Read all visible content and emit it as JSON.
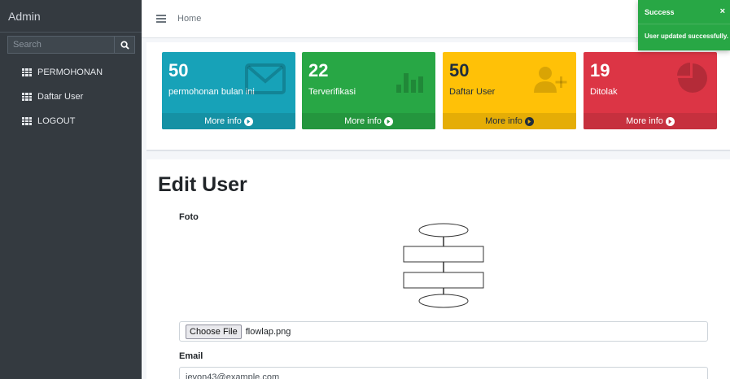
{
  "sidebar": {
    "brand": "Admin",
    "search_placeholder": "Search",
    "items": [
      {
        "label": "PERMOHONAN"
      },
      {
        "label": "Daftar User"
      },
      {
        "label": "LOGOUT"
      }
    ]
  },
  "topbar": {
    "home": "Home"
  },
  "boxes": [
    {
      "number": "50",
      "label": "permohonan bulan ini",
      "footer": "More info",
      "color": "#17a2b8",
      "icon": "envelope-icon"
    },
    {
      "number": "22",
      "label": "Terverifikasi",
      "footer": "More info",
      "color": "#28a745",
      "icon": "bar-chart-icon"
    },
    {
      "number": "50",
      "label": "Daftar User",
      "footer": "More info",
      "color": "#ffc107",
      "icon": "user-plus-icon"
    },
    {
      "number": "19",
      "label": "Ditolak",
      "footer": "More info",
      "color": "#dc3545",
      "icon": "pie-chart-icon"
    }
  ],
  "form": {
    "title": "Edit User",
    "photo_label": "Foto",
    "choose_file": "Choose File",
    "file_name": "flowlap.png",
    "email_label": "Email",
    "email_value": "jevon43@example.com"
  },
  "toast": {
    "title": "Success",
    "message": "User updated successfully.",
    "close": "×",
    "color": "#28a745"
  }
}
